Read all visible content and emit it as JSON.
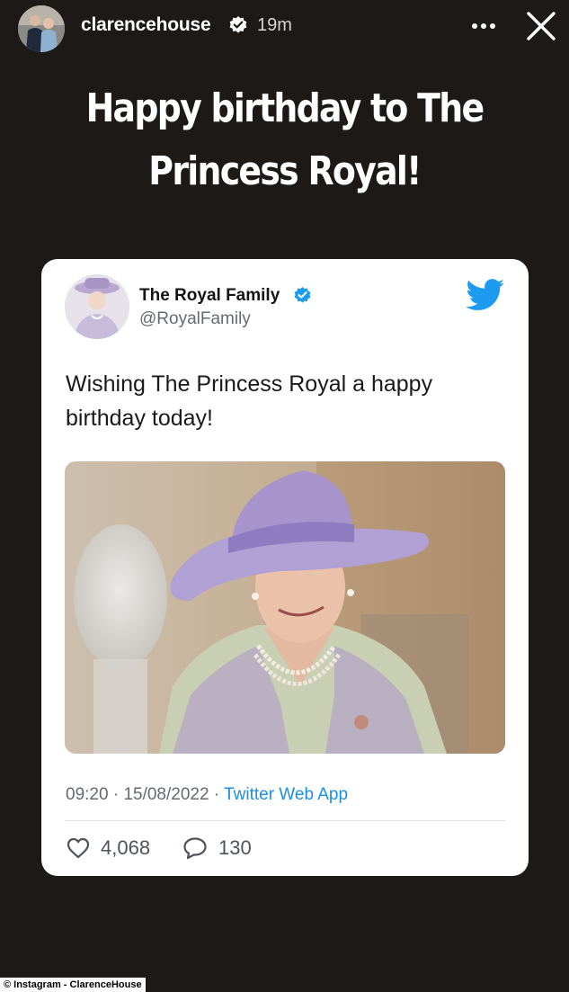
{
  "story": {
    "username": "clarencehouse",
    "time_ago": "19m",
    "caption_line1": "Happy birthday to The",
    "caption_line2": "Princess Royal!",
    "icons": {
      "verified": "verified-badge-icon",
      "more": "more-options-icon",
      "close": "close-icon"
    }
  },
  "tweet": {
    "display_name": "The Royal Family",
    "handle": "@RoyalFamily",
    "text_line1": "Wishing The Princess Royal a happy",
    "text_line2": "birthday today!",
    "time": "09:20",
    "date": "15/08/2022",
    "source": "Twitter Web App",
    "likes": "4,068",
    "replies": "130",
    "icons": {
      "platform": "twitter-bird-icon",
      "like": "heart-icon",
      "reply": "reply-bubble-icon"
    }
  },
  "watermark": "© Instagram - ClarenceHouse",
  "colors": {
    "background": "#1c1916",
    "card": "#ffffff",
    "twitter_blue": "#1d9bf0",
    "source_link": "#1d8ede",
    "muted_text": "#666a70"
  }
}
